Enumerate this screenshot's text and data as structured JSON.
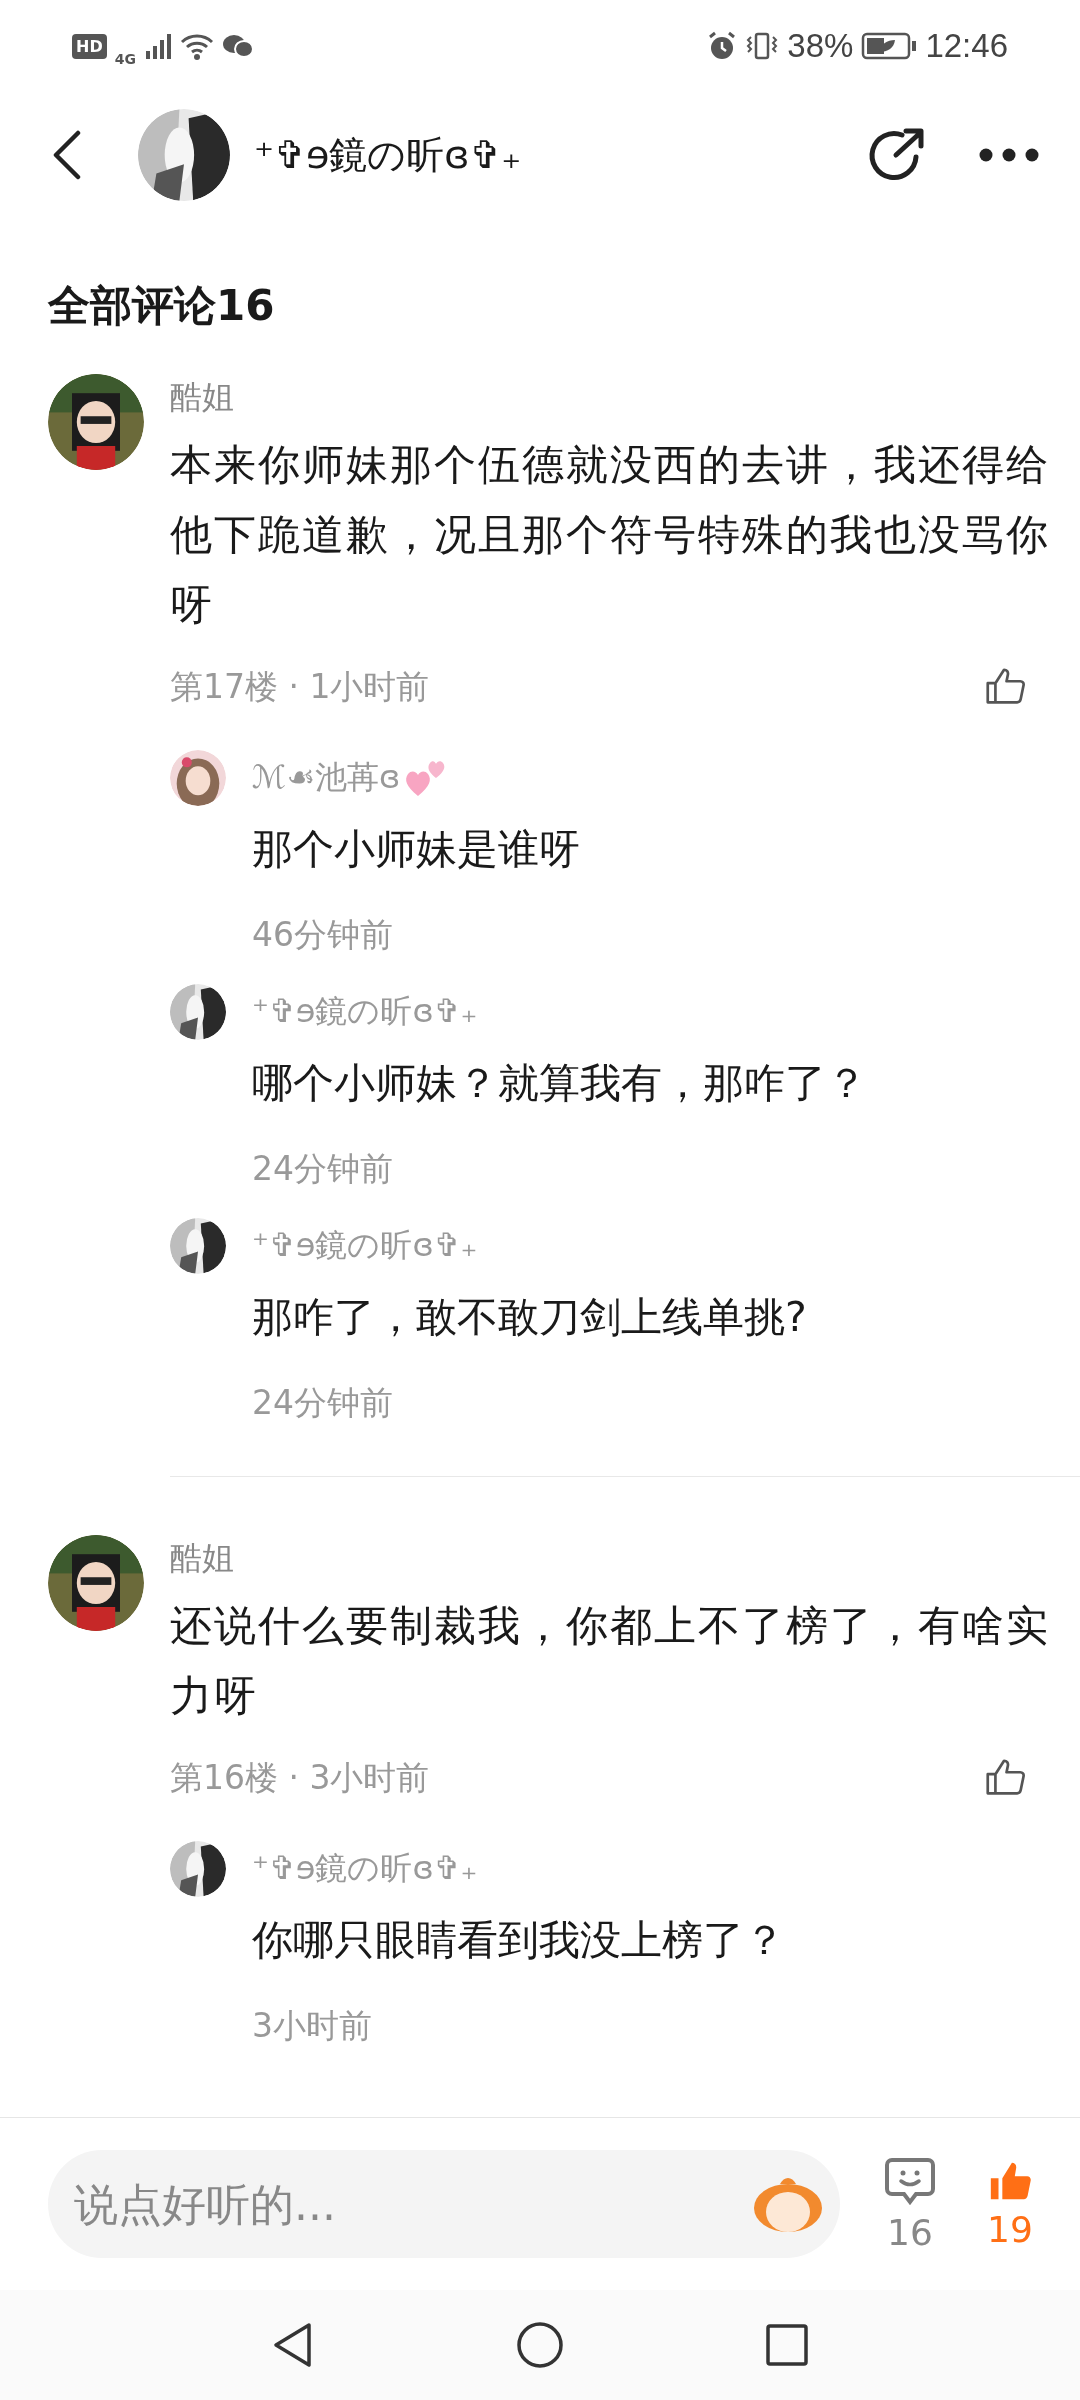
{
  "status_bar": {
    "hd": "HD",
    "network": "4G",
    "battery": "38%",
    "time": "12:46"
  },
  "header": {
    "title": "⁺✞ɘ鏡の昕ɞ✞₊"
  },
  "section_title": "全部评论16",
  "comments": [
    {
      "name": "酷姐",
      "text": "本来你师妹那个伍德就没西的去讲，我还得给他下跪道歉，况且那个符号特殊的我也没骂你呀",
      "meta": "第17楼 · 1小时前",
      "liked": false,
      "replies": [
        {
          "name": "ℳ☙池苒ɞ",
          "hearts": true,
          "text": "那个小师妹是谁呀",
          "time": "46分钟前"
        },
        {
          "name": "⁺✞ɘ鏡の昕ɞ✞₊",
          "hearts": false,
          "text": "哪个小师妹？就算我有，那咋了？",
          "time": "24分钟前"
        },
        {
          "name": "⁺✞ɘ鏡の昕ɞ✞₊",
          "hearts": false,
          "text": "那咋了，敢不敢刀剑上线单挑?",
          "time": "24分钟前"
        }
      ]
    },
    {
      "name": "酷姐",
      "text": "还说什么要制裁我，你都上不了榜了，有啥实力呀",
      "meta": "第16楼 · 3小时前",
      "liked": false,
      "replies": [
        {
          "name": "⁺✞ɘ鏡の昕ɞ✞₊",
          "hearts": false,
          "text": "你哪只眼睛看到我没上榜了？",
          "time": "3小时前"
        }
      ]
    }
  ],
  "bottom_bar": {
    "placeholder": "说点好听的...",
    "comment_count": "16",
    "like_count": "19",
    "liked": true
  }
}
